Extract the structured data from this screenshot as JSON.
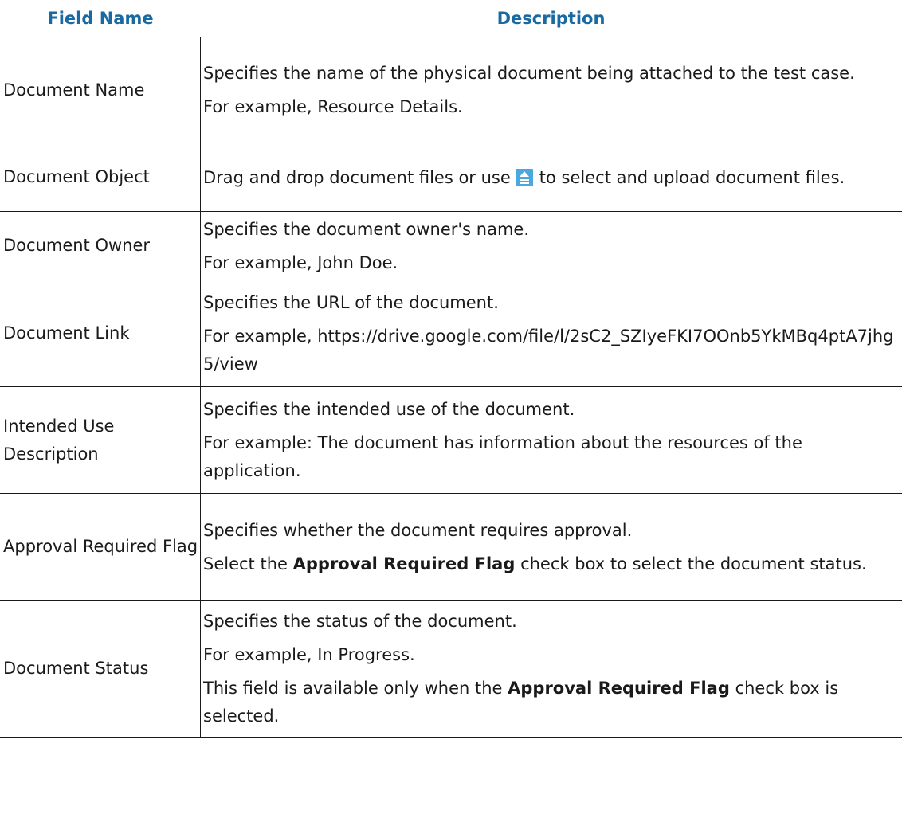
{
  "table": {
    "headers": {
      "field_name": "Field Name",
      "description": "Description"
    },
    "rows": [
      {
        "field": "Document Name",
        "desc": [
          "Specifies the name of the physical document being attached to the test case.",
          "For example, Resource Details."
        ]
      },
      {
        "field": "Document Object",
        "desc_object": {
          "before_icon": "Drag and drop document files or use",
          "icon": "upload-icon",
          "after_icon": "to select and upload document files."
        }
      },
      {
        "field": "Document Owner",
        "desc": [
          "Specifies the document owner's name.",
          "For example, John Doe."
        ]
      },
      {
        "field": "Document Link",
        "desc": [
          "Specifies the URL of the document.",
          "For example, https://drive.google.com/file/l/2sC2_SZIyeFKI7OOnb5YkMBq4ptA7jhg5/view"
        ]
      },
      {
        "field": "Intended Use Description",
        "desc": [
          "Specifies the intended use of the document.",
          "For example: The document has information about the resources of the application."
        ]
      },
      {
        "field": "Approval Required Flag",
        "desc_flag": {
          "line1": "Specifies whether the document requires approval.",
          "line2_pre": "Select the",
          "line2_bold": "Approval Required Flag",
          "line2_post": "check box to select the document status."
        }
      },
      {
        "field": "Document Status",
        "desc_status": {
          "line1": "Specifies the status of the document.",
          "line2": "For example, In Progress.",
          "line3_pre": "This field is available only when the",
          "line3_bold": "Approval Required Flag",
          "line3_post": "check box is selected."
        }
      }
    ]
  },
  "colors": {
    "header_text": "#1a6aa1",
    "upload_icon": "#4aa8e0"
  }
}
